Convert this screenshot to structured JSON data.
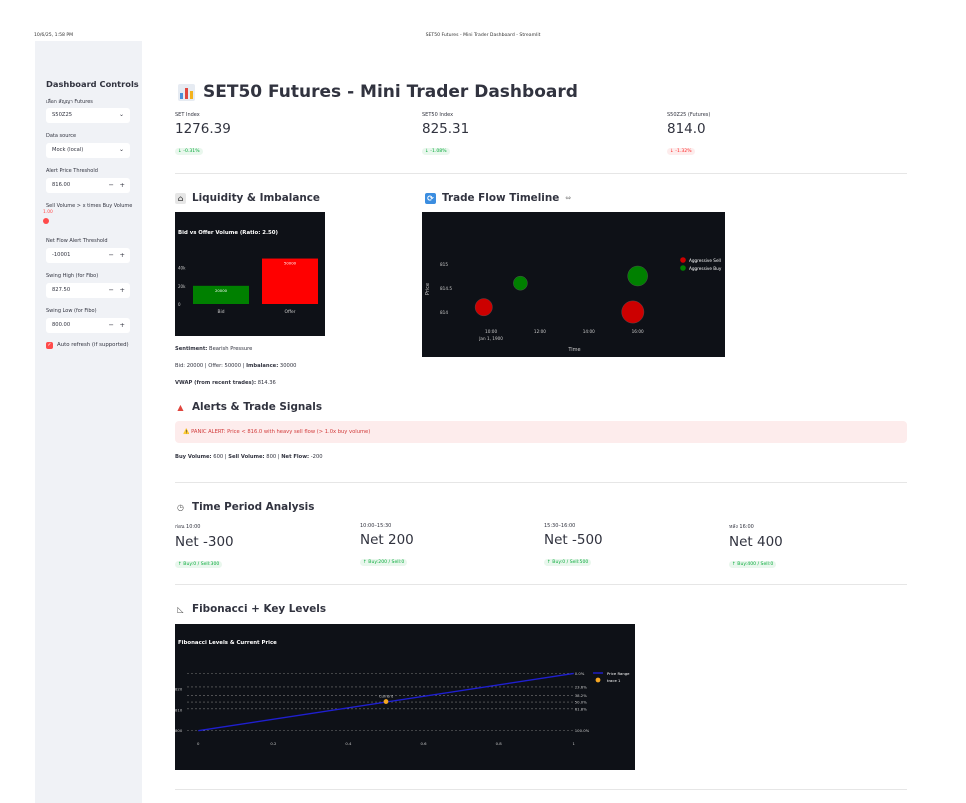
{
  "window": {
    "timestamp": "10/6/25, 1:58 PM",
    "title": "SET50 Futures - Mini Trader Dashboard - Streamlit"
  },
  "sidebar": {
    "title": "Dashboard Controls",
    "contract_label": "เลือก สัญญา Futures",
    "contract_value": "S50Z25",
    "source_label": "Data source",
    "source_value": "Mock (local)",
    "alert_label": "Alert Price Threshold",
    "alert_value": "816.00",
    "sell_label": "Sell Volume > x times Buy Volume",
    "sell_value": "1.00",
    "netflow_label": "Net Flow Alert Threshold",
    "netflow_value": "-10001",
    "swing_high_label": "Swing High (for Fibo)",
    "swing_high_value": "827.50",
    "swing_low_label": "Swing Low (for Fibo)",
    "swing_low_value": "800.00",
    "autorefresh_label": "Auto refresh (if supported)",
    "autorefresh_checked": true,
    "minus": "−",
    "plus": "+"
  },
  "header": {
    "title": "SET50 Futures - Mini Trader Dashboard"
  },
  "metrics": [
    {
      "label": "SET Index",
      "value": "1276.39",
      "delta": "↓ -0.31%",
      "delta_style": "down"
    },
    {
      "label": "SET50 Index",
      "value": "825.31",
      "delta": "↓ -1.08%",
      "delta_style": "down"
    },
    {
      "label": "S50Z25 (Futures)",
      "value": "814.0",
      "delta": "↓ -1.32%",
      "delta_style": "red"
    }
  ],
  "liquidity": {
    "heading": "Liquidity & Imbalance",
    "sentiment_label": "Sentiment:",
    "sentiment_value": "Bearish Pressure",
    "bid_line_a": "Bid: 20000 | Offer: 50000 | ",
    "bid_line_b": "Imbalance:",
    "bid_line_c": " 30000",
    "vwap_label": "VWAP (from recent trades):",
    "vwap_value": "814.36"
  },
  "tradeflow": {
    "heading": "Trade Flow Timeline",
    "link_icon": "⇔"
  },
  "alerts": {
    "heading": "Alerts & Trade Signals",
    "panic_text": "⚠️ PANIC ALERT: Price < 816.0 with heavy sell flow (> 1.0x buy volume)",
    "buy_label": "Buy Volume:",
    "buy_value": "600",
    "sell_label": "Sell Volume:",
    "sell_value": "800",
    "net_label": "Net Flow:",
    "net_value": "-200"
  },
  "time_period": {
    "heading": "Time Period Analysis",
    "periods": [
      {
        "label": "ก่อน 10:00",
        "value": "Net -300",
        "delta": "↑ Buy:0 / Sell:300"
      },
      {
        "label": "10:00–15:30",
        "value": "Net 200",
        "delta": "↑ Buy:200 / Sell:0"
      },
      {
        "label": "15:30–16:00",
        "value": "Net -500",
        "delta": "↑ Buy:0 / Sell:500"
      },
      {
        "label": "หลัง 16:00",
        "value": "Net 400",
        "delta": "↑ Buy:400 / Sell:0"
      }
    ]
  },
  "fibo": {
    "heading": "Fibonacci + Key Levels"
  },
  "chart_data": [
    {
      "type": "bar",
      "title": "Bid vs Offer Volume (Ratio: 2.50)",
      "categories": [
        "Bid",
        "Offer"
      ],
      "values": [
        20000,
        50000
      ],
      "value_labels": [
        "20000",
        "50000"
      ],
      "colors": [
        "#008000",
        "#ff0000"
      ],
      "yticks": [
        "0",
        "20k",
        "40k"
      ],
      "ylim": [
        0,
        55000
      ]
    },
    {
      "type": "scatter",
      "title": "",
      "xlabel": "Time",
      "ylabel": "Price",
      "xticks": [
        "10:00",
        "12:00",
        "14:00",
        "16:00"
      ],
      "xtick_sub": "Jan 1, 1900",
      "yticks": [
        "814",
        "814.5",
        "815"
      ],
      "xlim": [
        8.4,
        17.2
      ],
      "ylim": [
        813.75,
        815.25
      ],
      "series": [
        {
          "name": "Aggressive Sell",
          "color": "#cc0000",
          "points": [
            {
              "x": 9.7,
              "y": 814.1,
              "size": 300
            },
            {
              "x": 15.8,
              "y": 814.0,
              "size": 500
            }
          ]
        },
        {
          "name": "Aggressive Buy",
          "color": "#008000",
          "points": [
            {
              "x": 11.2,
              "y": 814.6,
              "size": 200
            },
            {
              "x": 16.0,
              "y": 814.75,
              "size": 400
            }
          ]
        }
      ]
    },
    {
      "type": "line",
      "title": "Fibonacci Levels & Current Price",
      "xticks": [
        "0",
        "0.2",
        "0.4",
        "0.6",
        "0.8",
        "1"
      ],
      "yticks": [
        "800",
        "810",
        "820"
      ],
      "xlim": [
        -0.03,
        1.03
      ],
      "ylim": [
        797,
        832
      ],
      "levels": [
        {
          "label": "0.0%",
          "y": 827.5
        },
        {
          "label": "23.6%",
          "y": 821.01
        },
        {
          "label": "38.2%",
          "y": 816.99
        },
        {
          "label": "50.0%",
          "y": 813.75
        },
        {
          "label": "61.8%",
          "y": 810.51
        },
        {
          "label": "100.0%",
          "y": 800.0
        }
      ],
      "price_range": {
        "name": "Price Range",
        "points": [
          {
            "x": 0,
            "y": 800
          },
          {
            "x": 1,
            "y": 827.5
          }
        ]
      },
      "current": {
        "label": "Current",
        "x": 0.5,
        "y": 814.0
      },
      "legend": [
        "Price Range",
        "trace 1"
      ]
    }
  ]
}
